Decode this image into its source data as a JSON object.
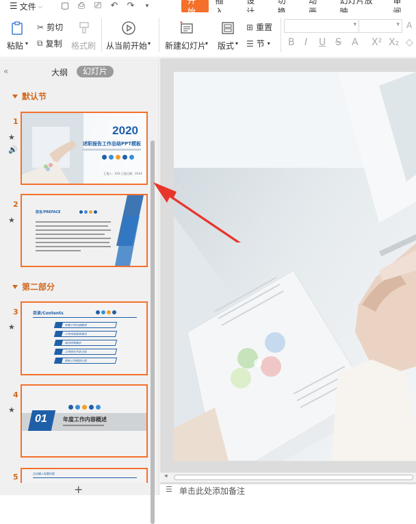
{
  "menu": {
    "file_label": "文件",
    "tabs": [
      "开始",
      "插入",
      "设计",
      "切换",
      "动画",
      "幻灯片放映",
      "审阅"
    ]
  },
  "ribbon": {
    "paste_label": "粘贴",
    "cut_label": "剪切",
    "copy_label": "复制",
    "format_painter_label": "格式刷",
    "play_from_current_label": "从当前开始",
    "new_slide_label": "新建幻灯片",
    "layout_label": "版式",
    "reset_label": "重置",
    "section_label": "节"
  },
  "left_pane": {
    "tab_outline": "大纲",
    "tab_slides": "幻灯片",
    "sections": [
      {
        "label": "默认节"
      },
      {
        "label": "第二部分"
      }
    ],
    "slides": [
      {
        "num": "1",
        "year": "2020",
        "title": "述职报告工作总结PPT模板",
        "footer": "汇报人：XXX  汇报日期：XXXX"
      },
      {
        "num": "2",
        "heading": "前言/PREFACE"
      },
      {
        "num": "3",
        "heading": "目录/Contents",
        "items": [
          "年度工作内容概述",
          "工作完成具体情况",
          "成功项目展示",
          "工作存在不足之处",
          "明年工作规划计划"
        ]
      },
      {
        "num": "4",
        "number": "01",
        "title": "年度工作内容概述"
      },
      {
        "num": "5",
        "heading": "点击输入标题内容"
      }
    ]
  },
  "notes_placeholder": "单击此处添加备注",
  "colors": {
    "accent": "#f4702b",
    "section": "#d2691e",
    "slide_blue": "#1e5fa8"
  }
}
